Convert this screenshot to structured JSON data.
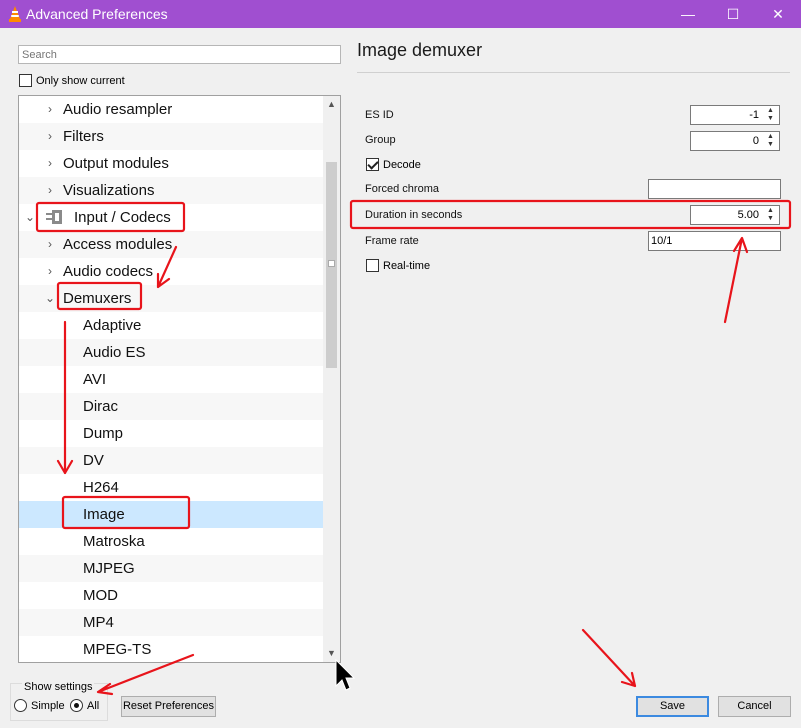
{
  "window": {
    "title": "Advanced Preferences",
    "min_glyph": "—",
    "max_glyph": "☐",
    "close_glyph": "✕"
  },
  "search": {
    "placeholder": "Search"
  },
  "only_show_current": {
    "label": "Only show current",
    "checked": false
  },
  "tree": {
    "rows": [
      {
        "label": "Audio resampler",
        "expander": "›"
      },
      {
        "label": "Filters",
        "expander": "›"
      },
      {
        "label": "Output modules",
        "expander": "›"
      },
      {
        "label": "Visualizations",
        "expander": "›"
      },
      {
        "label": "Input / Codecs",
        "expander": "⌄",
        "icon": "codec-icon"
      },
      {
        "label": "Access modules",
        "expander": "›"
      },
      {
        "label": "Audio codecs",
        "expander": "›"
      },
      {
        "label": "Demuxers",
        "expander": "⌄"
      },
      {
        "label": "Adaptive"
      },
      {
        "label": "Audio ES"
      },
      {
        "label": "AVI"
      },
      {
        "label": "Dirac"
      },
      {
        "label": "Dump"
      },
      {
        "label": "DV"
      },
      {
        "label": "H264"
      },
      {
        "label": "Image",
        "selected": true
      },
      {
        "label": "Matroska"
      },
      {
        "label": "MJPEG"
      },
      {
        "label": "MOD"
      },
      {
        "label": "MP4"
      },
      {
        "label": "MPEG-TS"
      }
    ]
  },
  "panel": {
    "title": "Image demuxer",
    "es_id": {
      "label": "ES ID",
      "value": "-1"
    },
    "group": {
      "label": "Group",
      "value": "0"
    },
    "decode": {
      "label": "Decode",
      "checked": true
    },
    "forced_chroma": {
      "label": "Forced chroma",
      "value": ""
    },
    "duration": {
      "label": "Duration in seconds",
      "value": "5.00"
    },
    "frame_rate": {
      "label": "Frame rate",
      "value": "10/1"
    },
    "realtime": {
      "label": "Real-time",
      "checked": false
    }
  },
  "show_settings": {
    "title": "Show settings",
    "simple_label": "Simple",
    "all_label": "All",
    "selected": "All"
  },
  "buttons": {
    "reset": "Reset Preferences",
    "save": "Save",
    "cancel": "Cancel"
  },
  "colors": {
    "titlebar": "#a04fd0",
    "selection": "#cce8ff",
    "annotation": "#e8141b"
  }
}
